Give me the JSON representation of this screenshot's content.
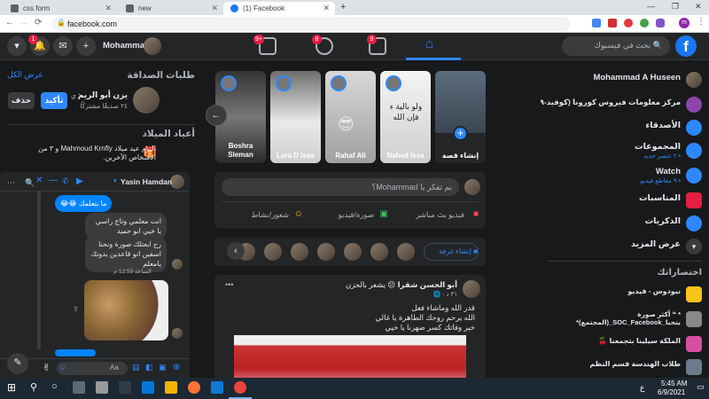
{
  "browser": {
    "tabs": [
      {
        "title": "css form",
        "active": false
      },
      {
        "title": "new",
        "active": false
      },
      {
        "title": "(1) Facebook",
        "active": true
      }
    ],
    "new_tab": "+",
    "url": "facebook.com",
    "window_controls": [
      "—",
      "❐",
      "✕"
    ]
  },
  "topbar": {
    "search_placeholder": "بحث في فيسبوك",
    "user_name": "Mohammad",
    "notif_badge": "1",
    "nav_badges": {
      "watch": "9",
      "groups": "8",
      "gaming": "9+"
    },
    "logo": "f"
  },
  "left_sidebar": {
    "profile": "Mohammad A Huseen",
    "items": [
      {
        "label": "مركز معلومات فيروس كورونا (كوفيد-١٩)",
        "sub": "",
        "icon": "covid-info-icon",
        "color": "#8e44ad"
      },
      {
        "label": "الأصدقاء",
        "sub": "",
        "icon": "friends-icon",
        "color": "#2d88ff"
      },
      {
        "label": "المجموعات",
        "sub": "• ٢ عنصر جديد",
        "icon": "groups-icon",
        "color": "#2d88ff"
      },
      {
        "label": "Watch",
        "sub": "• ٩ مقاطع فيديو",
        "icon": "watch-icon",
        "color": "#2d88ff"
      },
      {
        "label": "المناسبات",
        "sub": "",
        "icon": "events-icon",
        "color": "#e41e3f"
      },
      {
        "label": "الذكريات",
        "sub": "",
        "icon": "memories-icon",
        "color": "#2d88ff"
      },
      {
        "label": "عرض المزيد",
        "sub": "",
        "icon": "chevron-down-icon",
        "color": "#3a3b3c"
      }
    ],
    "shortcuts_title": "اختصاراتك",
    "shortcuts": [
      {
        "label": "نيودوس - فيديو"
      },
      {
        "label": "* ❝ أكثر صورة بتحبا_SOC_Facebook_(المجتمع)*"
      },
      {
        "label": "الملكة سيلينا بتجمعنا 🍒"
      },
      {
        "label": "طلاب الهندسة قسم النظم"
      }
    ]
  },
  "stories": [
    {
      "name": "إنشاء قصة",
      "create": true
    },
    {
      "name": "Nahed Issa"
    },
    {
      "name": "Rahaf Ali"
    },
    {
      "name": "Lara D Issa"
    },
    {
      "name": "Boshra Sleman"
    }
  ],
  "composer": {
    "placeholder": "بم تفكر يا Mohammad؟",
    "live": "فيديو بث مباشر",
    "photo": "صورة/فيديو",
    "feeling": "شعور/نشاط"
  },
  "rooms": {
    "create_label": "إنشاء غرفة"
  },
  "post": {
    "author": "أبو الحسن شقرا",
    "feeling": "😔 يشعر بالحزن",
    "time": "٣١ د · 🌐",
    "text_lines": [
      "قدر الله وماشاء فعل",
      "الله يرحم روحك الطاهرة يا غالي",
      "خبر وفاتك كسر ضهرنا يا خيي"
    ],
    "menu": "•••"
  },
  "right_panel": {
    "friend_requests_title": "طلبات الصداقة",
    "see_all": "عرض الكل",
    "request": {
      "name": "يزن أبو الريم",
      "time": "١ ي",
      "mutual": "٢٤ صديقًا مشتركًا",
      "confirm": "تأكيد",
      "delete": "حذف"
    },
    "birthdays_title": "أعياد الميلاد",
    "birthday_text": "اليوم عيد ميلاد Mahmoud Krnfly و ٣ من الأشخاص الآخرين."
  },
  "chat": {
    "name": "Yasin Hamdan",
    "messages": [
      {
        "text": "ما بتعلمك 😂😂",
        "mine": true
      },
      {
        "text": "انت معلمي وتاج راسي يا خيي ابو حميد",
        "mine": false
      },
      {
        "text": "رح ابعتلك صورة ونحنا اسفين انو قاعدين بدونك يامعلم",
        "mine": false
      }
    ],
    "timestamp": "الساعة 12:59 م",
    "input_placeholder": "Aa",
    "emoji": "✌"
  },
  "taskbar": {
    "time": "5:45 AM",
    "date": "6/9/2021",
    "lang": "ع"
  }
}
